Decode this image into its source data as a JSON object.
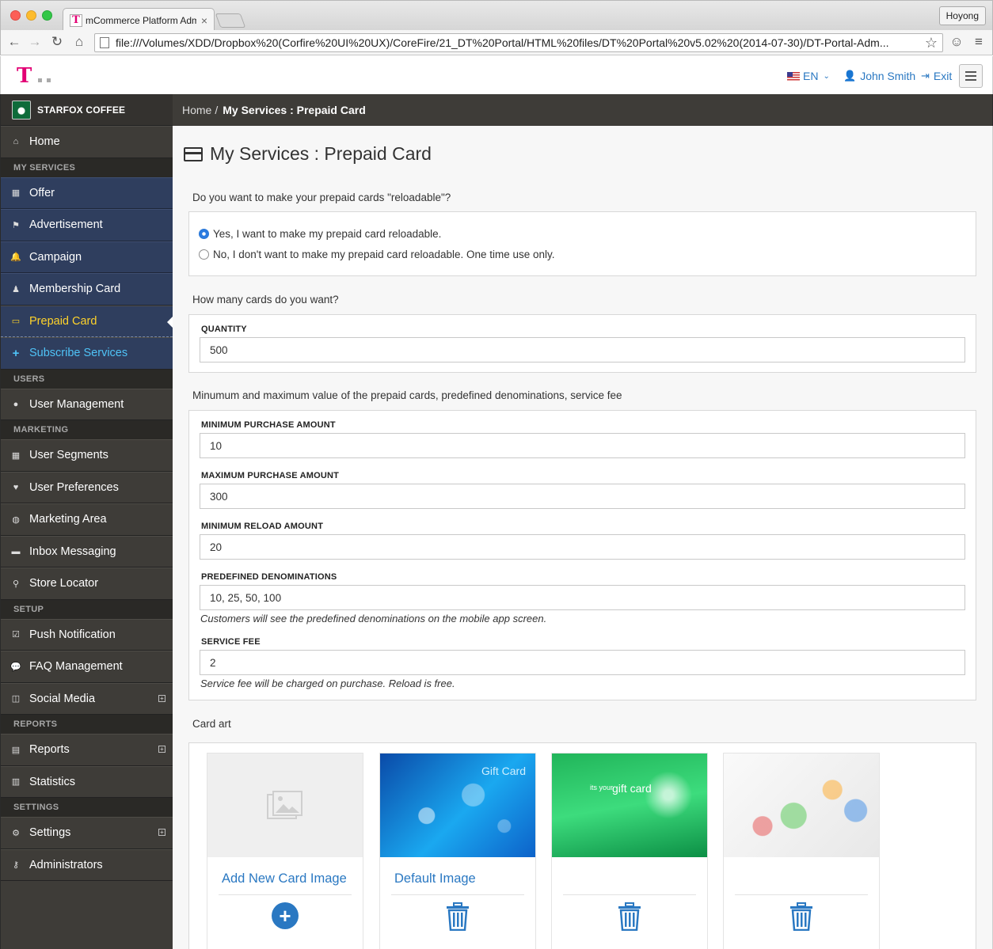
{
  "browser": {
    "tab_title": "mCommerce Platform Adm",
    "profile": "Hoyong",
    "url": "file:///Volumes/XDD/Dropbox%20(Corfire%20UI%20UX)/CoreFire/21_DT%20Portal/HTML%20files/DT%20Portal%20v5.02%20(2014-07-30)/DT-Portal-Adm..."
  },
  "header": {
    "logo": "T",
    "language": "EN",
    "user": "John Smith",
    "exit": "Exit"
  },
  "sidebar": {
    "brand": "STARFOX COFFEE",
    "home": "Home",
    "sections": {
      "my_services": "MY SERVICES",
      "users": "USERS",
      "marketing": "MARKETING",
      "setup": "SETUP",
      "reports": "REPORTS",
      "settings": "SETTINGS"
    },
    "services": [
      "Offer",
      "Advertisement",
      "Campaign",
      "Membership Card",
      "Prepaid Card",
      "Subscribe Services"
    ],
    "users": [
      "User Management"
    ],
    "marketing": [
      "User Segments",
      "User Preferences",
      "Marketing Area",
      "Inbox Messaging",
      "Store Locator"
    ],
    "setup": [
      "Push Notification",
      "FAQ Management",
      "Social Media"
    ],
    "reports": [
      "Reports",
      "Statistics"
    ],
    "settings": [
      "Settings",
      "Administrators"
    ]
  },
  "breadcrumb": {
    "home": "Home",
    "sep": "/",
    "current": "My Services : Prepaid Card"
  },
  "page": {
    "title": "My Services : Prepaid Card",
    "reload_question": "Do you want to make your prepaid cards \"reloadable\"?",
    "reload_yes": "Yes, I want to make my prepaid card reloadable.",
    "reload_no": "No, I don't want to make my prepaid card reloadable. One time use only.",
    "qty_question": "How many cards do you want?",
    "qty_label": "QUANTITY",
    "qty_value": "500",
    "values_question": "Minumum and maximum value of the prepaid cards, predefined denominations, service fee",
    "min_purchase_label": "MINIMUM PURCHASE AMOUNT",
    "min_purchase_value": "10",
    "max_purchase_label": "MAXIMUM PURCHASE AMOUNT",
    "max_purchase_value": "300",
    "min_reload_label": "MINIMUM RELOAD AMOUNT",
    "min_reload_value": "20",
    "denominations_label": "PREDEFINED DENOMINATIONS",
    "denominations_value": "10, 25, 50, 100",
    "denominations_help": "Customers will see the predefined denominations on the mobile app screen.",
    "service_fee_label": "SERVICE FEE",
    "service_fee_value": "2",
    "service_fee_help": "Service fee will be charged on purchase. Reload is free.",
    "card_art_label": "Card art",
    "add_card_image": "Add New Card Image",
    "default_image": "Default Image",
    "gift_card_1": "Gift Card",
    "gift_card_2": "gift card",
    "gift_card_2_prefix": "its your"
  },
  "colors": {
    "accent": "#2a78c2",
    "active_nav": "#ffd32a",
    "subscribe": "#4fc3f7",
    "sidebar_bg": "#3e3c38",
    "service_bg": "#2f3e5e",
    "brand_magenta": "#e20074"
  }
}
